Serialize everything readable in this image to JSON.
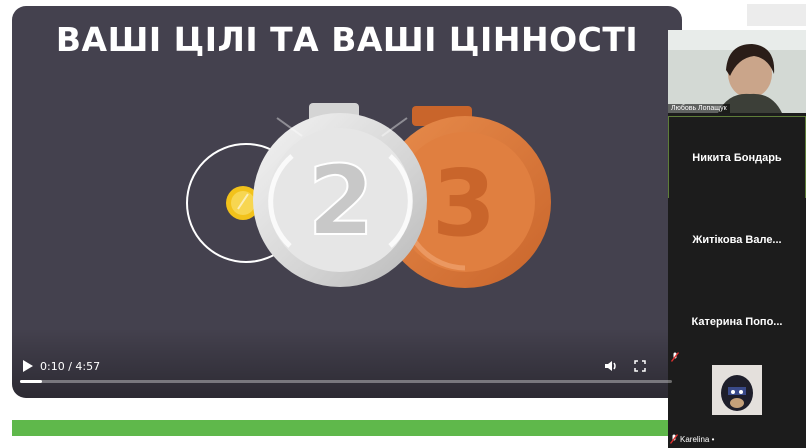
{
  "slide": {
    "title": "ВАШІ ЦІЛІ ТА ВАШІ ЦІННОСТІ"
  },
  "player": {
    "time": "0:10 / 4:57",
    "progress": 0.034,
    "play_icon": "play-icon",
    "volume_icon": "volume-icon",
    "fullscreen_icon": "fullscreen-icon"
  },
  "participants": {
    "video_name": "Любовь Лопащук",
    "tiles": [
      {
        "name": "Никита Бондарь"
      },
      {
        "name": "Житікова Вале..."
      },
      {
        "name": "Катерина Попо..."
      }
    ],
    "bottom_name": "Karelina •"
  },
  "colors": {
    "slide_bg": "#44414e",
    "accent_green": "#5fb84b",
    "bronze": "#d97a3c",
    "silver": "#d8d8d8",
    "gold": "#f2c21b"
  }
}
